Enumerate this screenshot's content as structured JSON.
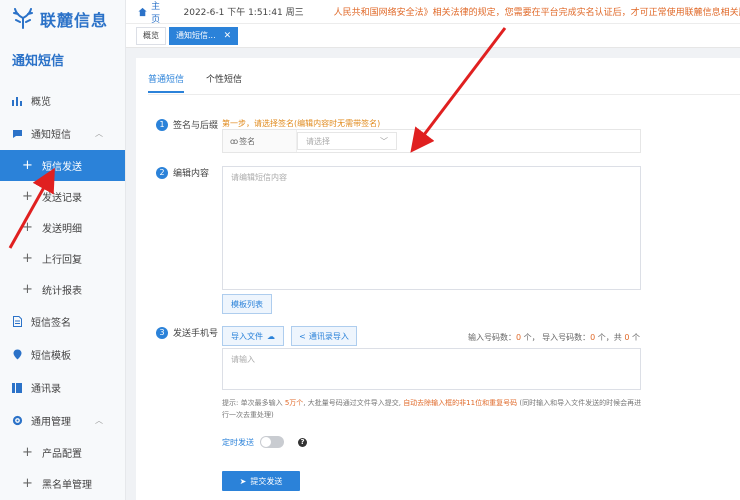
{
  "app": {
    "logo_text": "联麓信息",
    "module_title": "通知短信"
  },
  "sidebar": {
    "items": [
      {
        "label": "概览"
      },
      {
        "label": "通知短信"
      },
      {
        "label": "短信发送"
      },
      {
        "label": "发送记录"
      },
      {
        "label": "发送明细"
      },
      {
        "label": "上行回复"
      },
      {
        "label": "统计报表"
      },
      {
        "label": "短信签名"
      },
      {
        "label": "短信模板"
      },
      {
        "label": "通讯录"
      },
      {
        "label": "通用管理"
      },
      {
        "label": "产品配置"
      },
      {
        "label": "黑名单管理"
      }
    ]
  },
  "topbar": {
    "home": "主页",
    "datetime": "2022-6-1 下午 1:51:41 周三",
    "notice": "人民共和国网络安全法》相关法律的规定，您需要在平台完成实名认证后，才可正常使用联麓信息相关服务，请"
  },
  "tabs": [
    {
      "label": "概览"
    },
    {
      "label": "通知短信..."
    }
  ],
  "form": {
    "subtabs": [
      "普通短信",
      "个性短信"
    ],
    "step1": {
      "num": "1",
      "label": "签名与后缀",
      "hint": "第一步，请选择签名(编辑内容时无需带签名)",
      "sign_label": "签名",
      "select_placeholder": "请选择"
    },
    "step2": {
      "num": "2",
      "label": "编辑内容",
      "placeholder": "请编辑短信内容",
      "template_button": "模板列表"
    },
    "step3": {
      "num": "3",
      "label": "发送手机号",
      "import_file": "导入文件",
      "import_contacts": "通讯录导入",
      "count_prefix": "输入号码数：",
      "input_count": "0",
      "count_mid": " 个， 导入号码数：",
      "import_count": "0",
      "count_mid2": " 个，共 ",
      "total_count": "0",
      "count_suffix": " 个",
      "placeholder": "请输入",
      "tip_a": "提示: 单次最多输入 ",
      "tip_max": "5万个",
      "tip_b": ", 大批量号码通过文件导入提交, ",
      "tip_auto": "自动去除输入框的非11位和重复号码",
      "tip_c": " (同时输入和导入文件发送的时候会再进行一次去重处理)"
    },
    "timer_label": "定时发送",
    "timer_on": false,
    "help_glyph": "?",
    "submit": "提交发送"
  },
  "colors": {
    "accent": "#2b82d9",
    "warning": "#e06a2a",
    "arrow": "#e02020"
  }
}
